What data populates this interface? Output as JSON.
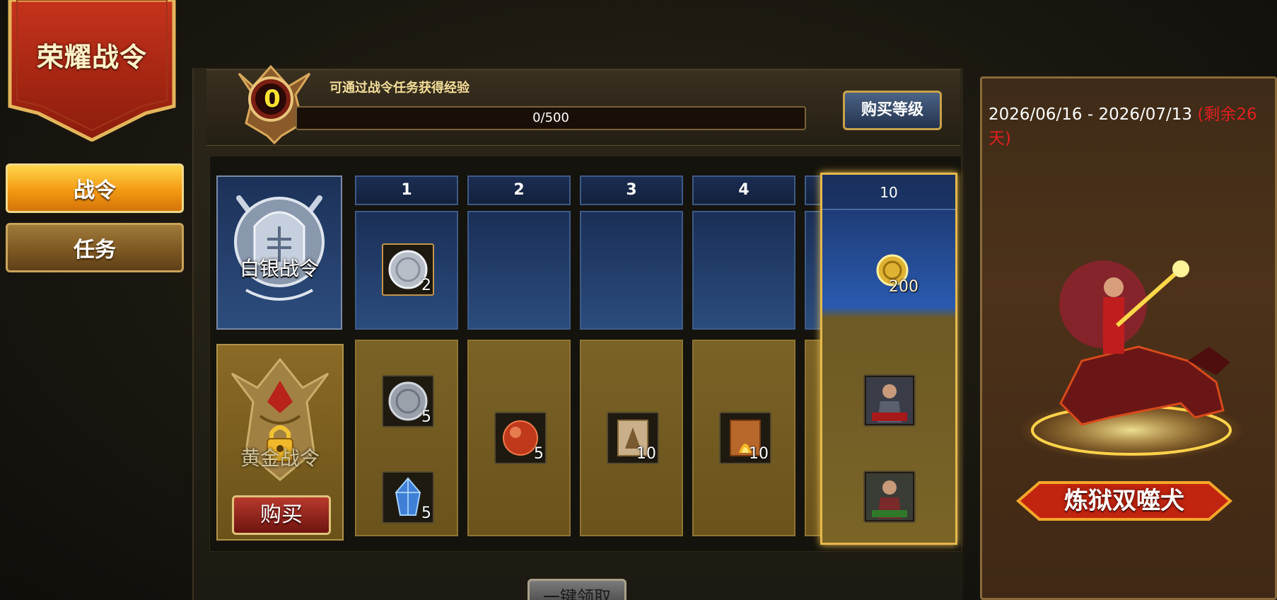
{
  "banner": {
    "title": "荣耀战令"
  },
  "sidebar": {
    "tabs": [
      {
        "label": "战令",
        "active": true
      },
      {
        "label": "任务",
        "active": false
      }
    ]
  },
  "exp": {
    "level": "0",
    "description": "可通过战令任务获得经验",
    "progress_text": "0/500",
    "progress_fraction": 0,
    "buy_level_label": "购买等级"
  },
  "passes": {
    "silver": {
      "label": "白银战令"
    },
    "gold": {
      "label": "黄金战令",
      "locked": true,
      "buy_label": "购买"
    }
  },
  "levels": [
    {
      "level": "1",
      "silver_items": [
        {
          "icon": "silver-coin-icon",
          "qty": "2"
        }
      ],
      "gold_items": [
        {
          "icon": "silver-coin-icon",
          "qty": "5"
        },
        {
          "icon": "blue-crystal-icon",
          "qty": "5"
        }
      ]
    },
    {
      "level": "2",
      "silver_items": [],
      "gold_items": [
        {
          "icon": "red-orb-icon",
          "qty": "5"
        }
      ]
    },
    {
      "level": "3",
      "silver_items": [],
      "gold_items": [
        {
          "icon": "scroll-icon",
          "qty": "10"
        }
      ]
    },
    {
      "level": "4",
      "silver_items": [],
      "gold_items": [
        {
          "icon": "fire-scroll-icon",
          "qty": "10"
        }
      ]
    },
    {
      "level": "10",
      "silver_items": [
        {
          "icon": "gold-coin-icon",
          "qty": "200"
        }
      ],
      "gold_items": [
        {
          "icon": "warrior-portrait-icon",
          "qty": ""
        },
        {
          "icon": "warrior-portrait-icon",
          "qty": ""
        }
      ]
    }
  ],
  "claim_all_label": "一键领取",
  "preview": {
    "date_range": "2026/06/16  - 2026/07/13",
    "remaining": "(剩余26天)",
    "mount_name": "炼狱双噬犬"
  },
  "colors": {
    "accent_gold": "#e5b84c",
    "remaining_red": "#e02020",
    "active_tab": "#ffd54a"
  }
}
